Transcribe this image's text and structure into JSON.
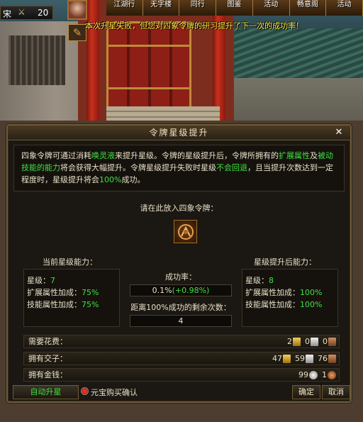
{
  "hud": {
    "player_name": "宋",
    "level": "20"
  },
  "menu": [
    "江湖行",
    "无字楼",
    "同行",
    "图鉴",
    "活动",
    "畅意阁",
    "活动"
  ],
  "notice": "本次升星失败，但您对四象令牌的研习提升了下一次的成功率！",
  "dialog": {
    "title": "令牌星级提升",
    "desc": {
      "p1": "四象令牌可通过消耗",
      "p2": "唤灵液",
      "p3": "来提升星级。令牌的星级提升后，令牌所拥有的",
      "p4": "扩展属性",
      "p5": "及",
      "p6": "被动技能的能力",
      "p7": "将会获得大幅提升。令牌星级提升失败时星级",
      "p8": "不会回退",
      "p9": "，且当提升次数达到一定程度时，星级提升将会",
      "p10": "100%",
      "p11": "成功。"
    },
    "prompt": "请在此放入四象令牌：",
    "current": {
      "heading": "当前星级能力：",
      "star_label": "星级：",
      "star_value": "7",
      "ext_label": "扩展属性加成：",
      "ext_value": "75%",
      "skill_label": "技能属性加成：",
      "skill_value": "75%"
    },
    "after": {
      "heading": "星级提升后能力：",
      "star_label": "星级：",
      "star_value": "8",
      "ext_label": "扩展属性加成：",
      "ext_value": "100%",
      "skill_label": "技能属性加成：",
      "skill_value": "100%"
    },
    "success": {
      "label": "成功率：",
      "base": "0.1%",
      "bonus": "(+0.98%)",
      "remain_label": "距离100%成功的剩余次数：",
      "remain_value": "4"
    },
    "cost": {
      "label": "需要花费：",
      "gold": "2",
      "silver": "0",
      "copper": "0"
    },
    "jiaozi": {
      "label": "拥有交子：",
      "gold": "47",
      "silver": "59",
      "copper": "76"
    },
    "money": {
      "label": "拥有金钱：",
      "silver": "99",
      "copper": "1"
    },
    "auto_button": "自动升星",
    "yuanbao_confirm": "元宝购买确认",
    "confirm_button": "确定",
    "cancel_button": "取消",
    "close": "✕"
  }
}
